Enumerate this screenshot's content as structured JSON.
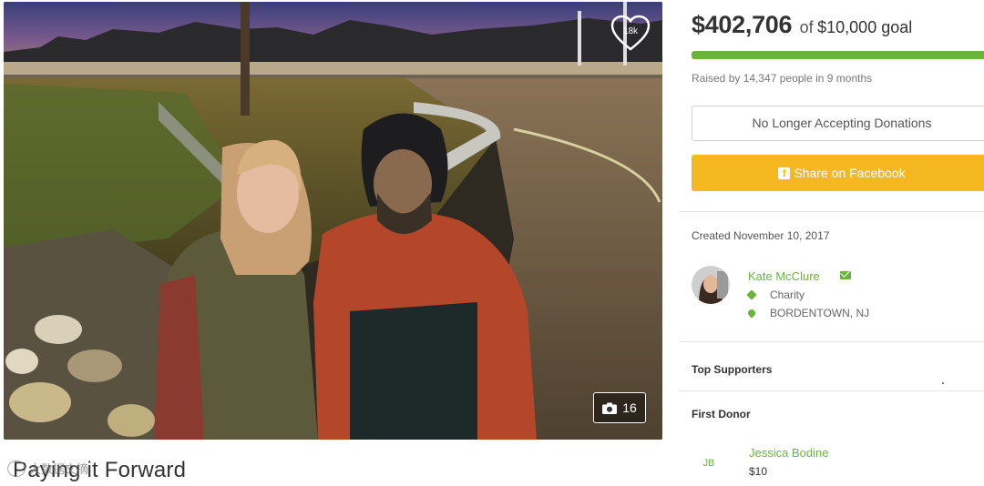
{
  "campaign": {
    "title": "Paying it Forward",
    "likes": "18k",
    "photo_count": "16",
    "photo_scene": "photo-of-two-people-by-roadside"
  },
  "donation": {
    "raised": "$402,706",
    "of_label": "of",
    "goal": "$10,000 goal",
    "progress_fraction": 1.0,
    "raised_by": "Raised by 14,347 people in 9 months",
    "status_button": "No Longer Accepting Donations",
    "share_button": "Share on Facebook",
    "created": "Created November 10, 2017"
  },
  "organizer": {
    "name": "Kate McClure",
    "category": "Charity",
    "location": "BORDENTOWN, NJ"
  },
  "sections": {
    "top_supporters": "Top Supporters",
    "first_donor": "First Donor"
  },
  "first_donor": {
    "initials": "JB",
    "name": "Jessica Bodine",
    "amount": "$10"
  },
  "watermark": {
    "text": "大数据文摘"
  },
  "colors": {
    "accent_green": "#6bb43b",
    "share_yellow": "#f6b821",
    "text_dark": "#333333"
  },
  "icons": [
    "heart-icon",
    "camera-icon",
    "facebook-icon",
    "mail-icon",
    "tag-icon",
    "map-pin-icon"
  ]
}
